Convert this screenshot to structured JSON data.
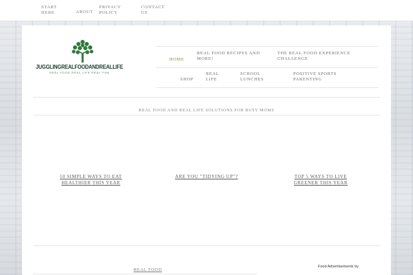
{
  "top_nav": [
    {
      "label_line1": "START",
      "label_line2": "HERE"
    },
    {
      "label_line1": "ABOUT",
      "label_line2": ""
    },
    {
      "label_line1": "PRIVACY",
      "label_line2": "POLICY"
    },
    {
      "label_line1": "CONTACT",
      "label_line2": "US"
    }
  ],
  "logo": {
    "wordmark": "JUGGLINGREALFOODANDREALLIFE",
    "tagline": "REAL FOOD REAL LIFE REAL FUN",
    "icon": "tree-icon",
    "colors": {
      "tree": "#2f7a3a",
      "text": "#1a3a2a",
      "tagline": "#2a7a5a"
    }
  },
  "main_nav": {
    "row1": [
      {
        "label_line1": "HOME",
        "label_line2": "",
        "active": true
      },
      {
        "label_line1": "REAL FOOD RECIPES AND",
        "label_line2": "MORE!"
      },
      {
        "label_line1": "THE REAL FOOD EXPERIENCE",
        "label_line2": "CHALLENGE"
      }
    ],
    "row2": [
      {
        "label_line1": "SHOP",
        "label_line2": ""
      },
      {
        "label_line1": "REAL",
        "label_line2": "LIFE"
      },
      {
        "label_line1": "SCHOOL",
        "label_line2": "LUNCHES"
      },
      {
        "label_line1": "POSITIVE SPORTS",
        "label_line2": "PARENTING"
      }
    ]
  },
  "tagline": "REAL FOOD AND REAL LIFE SOLUTIONS FOR BUSY MOMS",
  "featured_posts": [
    {
      "line1": "10 SIMPLE WAYS TO EAT",
      "line2": "HEALTHIER THIS YEAR"
    },
    {
      "line1": "ARE YOU \"TIDYING UP\"?",
      "line2": ""
    },
    {
      "line1": "TOP 5 WAYS TO LIVE",
      "line2": "GREENER THIS YEAR"
    }
  ],
  "bottom": {
    "category_label": "REAL FOOD",
    "ads_label": "Food Advertisements by"
  },
  "colors": {
    "accent": "#8a8a3a",
    "text": "#6f6f6f",
    "background_panel": "#ffffff"
  }
}
